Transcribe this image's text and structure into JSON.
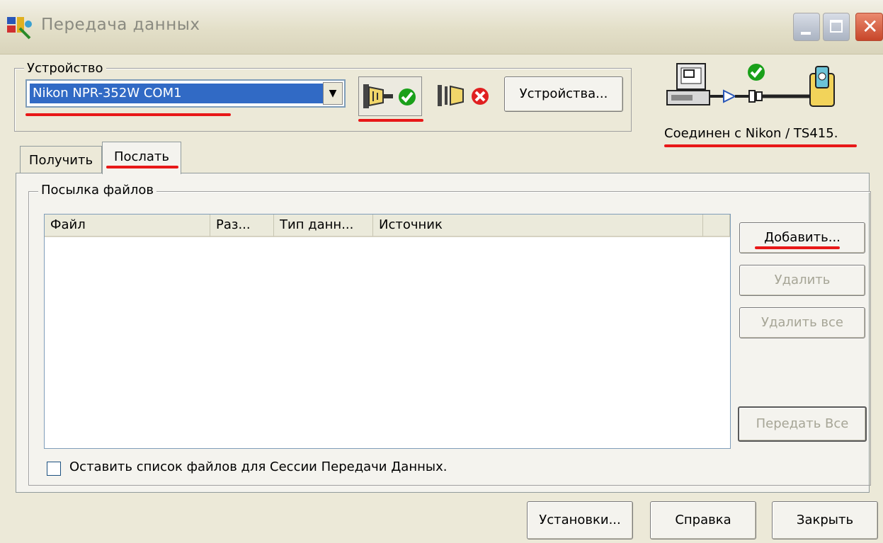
{
  "window": {
    "title": "Передача данных",
    "buttons": {
      "minimize": "minimize",
      "maximize": "maximize",
      "close": "✕"
    }
  },
  "device": {
    "group_label": "Устройство",
    "selected": "Nikon NPR-352W COM1",
    "connect_icon": "connect-icon",
    "disconnect_icon": "disconnect-icon",
    "devices_button": "Устройства..."
  },
  "connection": {
    "status_text": "Соединен с Nikon / TS415."
  },
  "tabs": [
    {
      "label": "Получить",
      "active": false
    },
    {
      "label": "Послать",
      "active": true
    }
  ],
  "send": {
    "group_label": "Посылка файлов",
    "columns": [
      "Файл",
      "Раз...",
      "Тип данн...",
      "Источник",
      ""
    ],
    "rows": [],
    "buttons": {
      "add": "Добавить...",
      "delete": "Удалить",
      "delete_all": "Удалить все",
      "send_all": "Передать Все"
    },
    "keep_list_label": "Оставить список файлов для Сессии Передачи Данных.",
    "keep_list_checked": false
  },
  "footer": {
    "settings": "Установки...",
    "help": "Справка",
    "close": "Закрыть"
  },
  "colors": {
    "accent": "#316ac5",
    "annotation": "#e81818",
    "ok": "#1aa01a",
    "err": "#e02020"
  }
}
